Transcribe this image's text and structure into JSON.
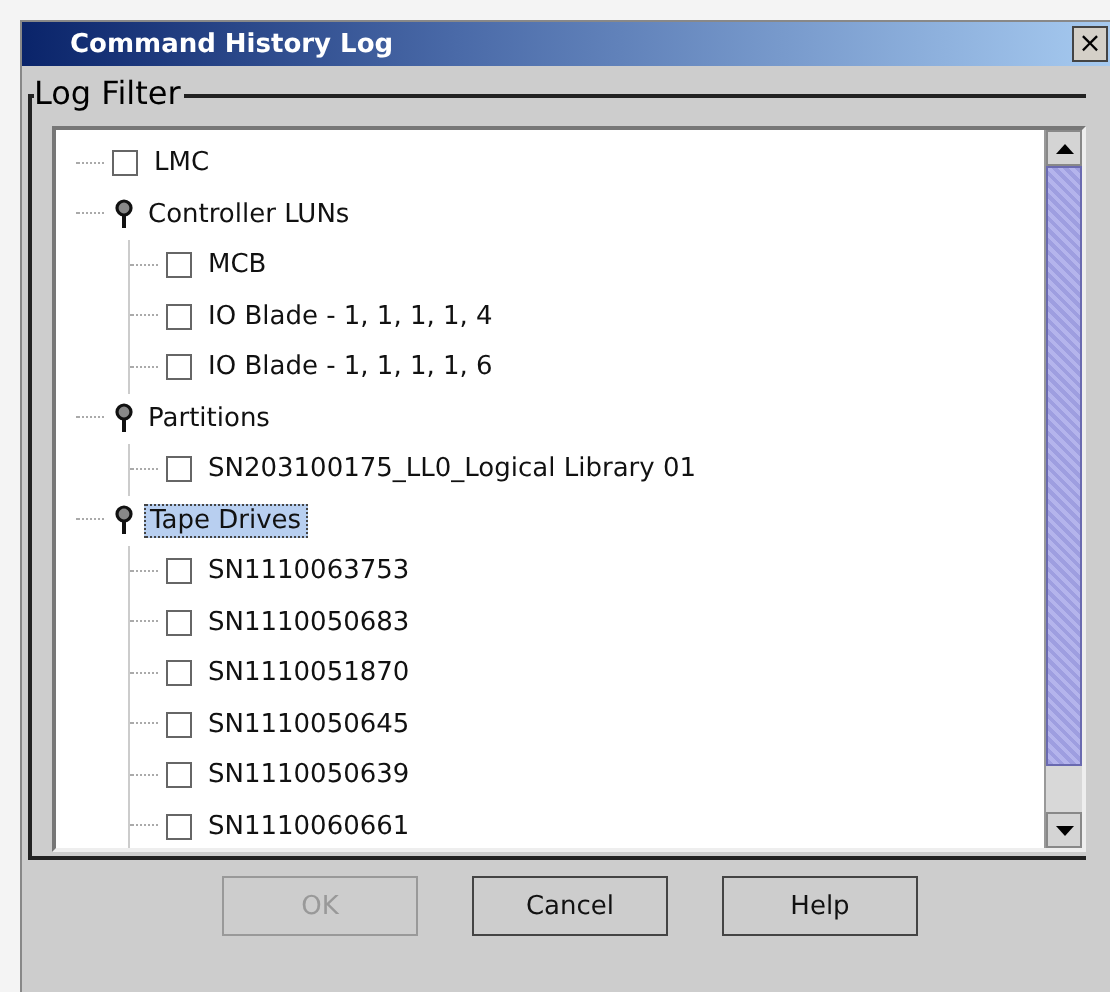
{
  "window": {
    "title": "Command History Log",
    "close": "×"
  },
  "group": {
    "title": "Log Filter"
  },
  "tree": {
    "items": [
      {
        "kind": "checkbox",
        "label": "LMC",
        "checked": false,
        "selected": false
      },
      {
        "kind": "folder",
        "label": "Controller LUNs",
        "expanded": true,
        "selected": false,
        "children": [
          {
            "kind": "checkbox",
            "label": "MCB",
            "checked": false,
            "selected": false
          },
          {
            "kind": "checkbox",
            "label": "IO Blade - 1, 1, 1, 1, 4",
            "checked": false,
            "selected": false
          },
          {
            "kind": "checkbox",
            "label": "IO Blade - 1, 1, 1, 1, 6",
            "checked": false,
            "selected": false
          }
        ]
      },
      {
        "kind": "folder",
        "label": "Partitions",
        "expanded": true,
        "selected": false,
        "children": [
          {
            "kind": "checkbox",
            "label": "SN203100175_LL0_Logical Library 01",
            "checked": false,
            "selected": false
          }
        ]
      },
      {
        "kind": "folder",
        "label": "Tape Drives",
        "expanded": true,
        "selected": true,
        "children": [
          {
            "kind": "checkbox",
            "label": "SN1110063753",
            "checked": false,
            "selected": false
          },
          {
            "kind": "checkbox",
            "label": "SN1110050683",
            "checked": false,
            "selected": false
          },
          {
            "kind": "checkbox",
            "label": "SN1110051870",
            "checked": false,
            "selected": false
          },
          {
            "kind": "checkbox",
            "label": "SN1110050645",
            "checked": false,
            "selected": false
          },
          {
            "kind": "checkbox",
            "label": "SN1110050639",
            "checked": false,
            "selected": false
          },
          {
            "kind": "checkbox",
            "label": "SN1110060661",
            "checked": false,
            "selected": false
          }
        ]
      }
    ]
  },
  "buttons": [
    {
      "label": "OK",
      "disabled": true
    },
    {
      "label": "Cancel",
      "disabled": false
    },
    {
      "label": "Help",
      "disabled": false
    }
  ]
}
